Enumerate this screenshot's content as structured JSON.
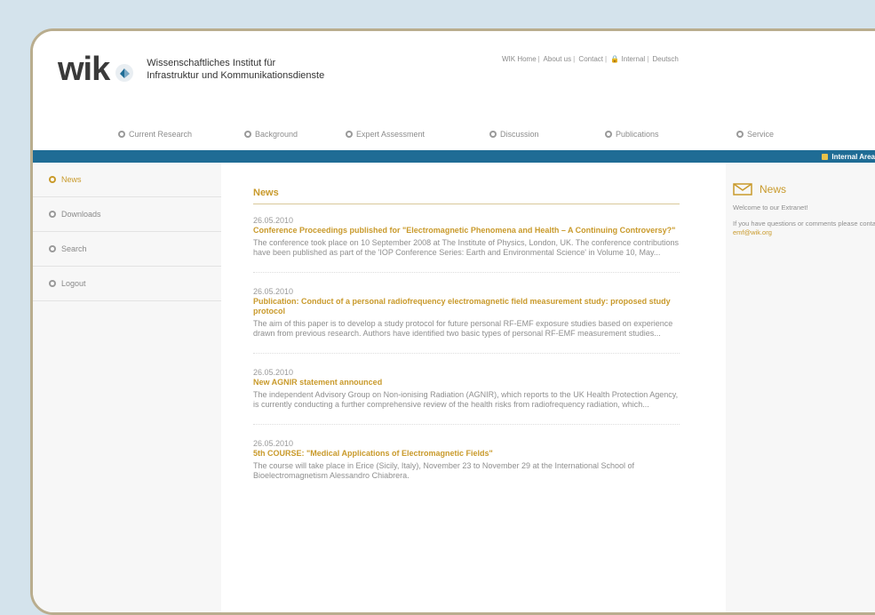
{
  "header": {
    "logo_word": "wik",
    "institute_line1": "Wissenschaftliches Institut für",
    "institute_line2": "Infrastruktur und Kommunikationsdienste",
    "top_links": [
      "WIK Home",
      "About us",
      "Contact",
      "Internal",
      "Deutsch"
    ]
  },
  "nav": [
    "Current Research",
    "Background",
    "Expert Assessment",
    "Discussion",
    "Publications",
    "Service"
  ],
  "bluebar": {
    "internal_label": "Internal Area"
  },
  "sidebar": [
    "News",
    "Downloads",
    "Search",
    "Logout"
  ],
  "main": {
    "title": "News",
    "items": [
      {
        "date": "26.05.2010",
        "title": "Conference Proceedings published for \"Electromagnetic Phenomena and Health – A Continuing Controversy?\"",
        "body": "The conference took place on 10 September 2008 at The Institute of Physics, London, UK. The conference contributions have been published as part of the 'IOP Conference Series: Earth and Environmental Science' in Volume 10, May..."
      },
      {
        "date": "26.05.2010",
        "title": "Publication: Conduct of a personal radiofrequency electromagnetic field measurement study: proposed study protocol",
        "body": "The aim of this paper is to develop a study protocol for future personal RF-EMF exposure studies based on experience drawn from previous research. Authors have identified two basic types of personal RF-EMF measurement studies..."
      },
      {
        "date": "26.05.2010",
        "title": "New AGNIR statement announced",
        "body": "The independent Advisory Group on Non-ionising Radiation (AGNIR), which reports to the UK Health Protection Agency, is currently conducting a further comprehensive review of the health risks from radiofrequency radiation, which..."
      },
      {
        "date": "26.05.2010",
        "title": "5th COURSE: \"Medical Applications of Electromagnetic Fields\"",
        "body": "The course will take place in Erice (Sicily, Italy), November 23 to November 29 at the International School of Bioelectromagnetism Alessandro Chiabrera."
      }
    ]
  },
  "right": {
    "title": "News",
    "welcome": "Welcome to our Extranet!",
    "contact_text": "If you have questions or comments please contact:",
    "contact_email": "emf@wik.org"
  },
  "colors": {
    "accent": "#c99a2b",
    "bar": "#1f6c95",
    "background": "#d4e3ec"
  }
}
